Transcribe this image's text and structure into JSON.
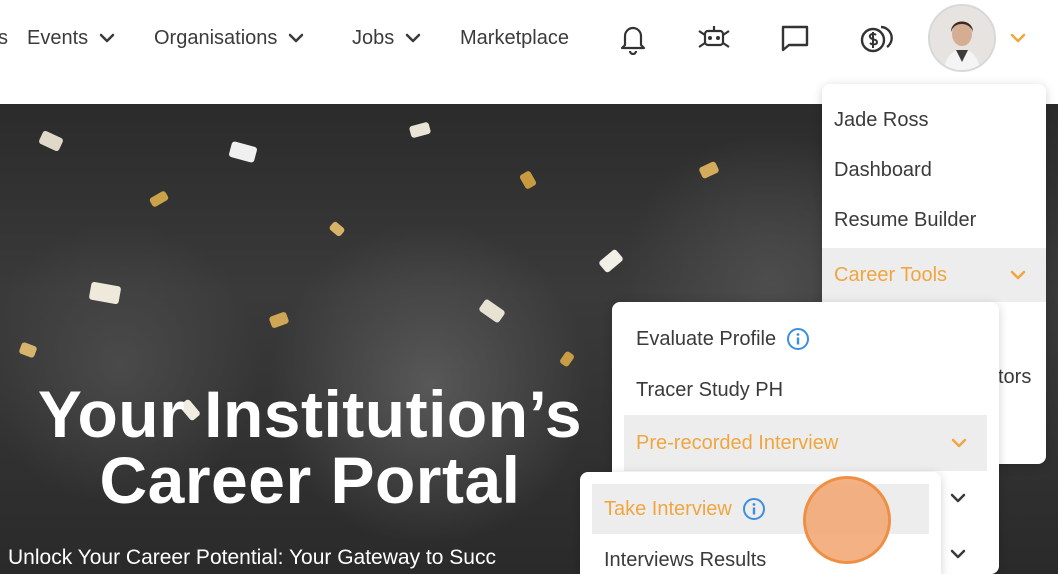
{
  "nav": {
    "items": [
      {
        "label": "s"
      },
      {
        "label": "Events"
      },
      {
        "label": "Organisations"
      },
      {
        "label": "Jobs"
      },
      {
        "label": "Marketplace"
      }
    ],
    "icons": [
      "bell-icon",
      "robot-icon",
      "chat-icon",
      "coins-icon"
    ]
  },
  "hero": {
    "title_line1": "Your Institution’s",
    "title_line2": "Career Portal",
    "subtitle": "Unlock Your Career Potential: Your Gateway to Succ"
  },
  "user_menu": {
    "items": [
      {
        "label": "Jade Ross"
      },
      {
        "label": "Dashboard"
      },
      {
        "label": "Resume Builder"
      },
      {
        "label": "Career Tools"
      }
    ],
    "partial_text": "tors"
  },
  "career_tools_menu": {
    "items": [
      {
        "label": "Evaluate Profile"
      },
      {
        "label": "Tracer Study PH"
      },
      {
        "label": "Pre-recorded Interview"
      }
    ]
  },
  "interview_menu": {
    "items": [
      {
        "label": "Take Interview"
      },
      {
        "label": "Interviews Results"
      }
    ]
  },
  "colors": {
    "accent": "#f0a640",
    "text": "#3a3a3a",
    "active_bg": "#ededed"
  }
}
